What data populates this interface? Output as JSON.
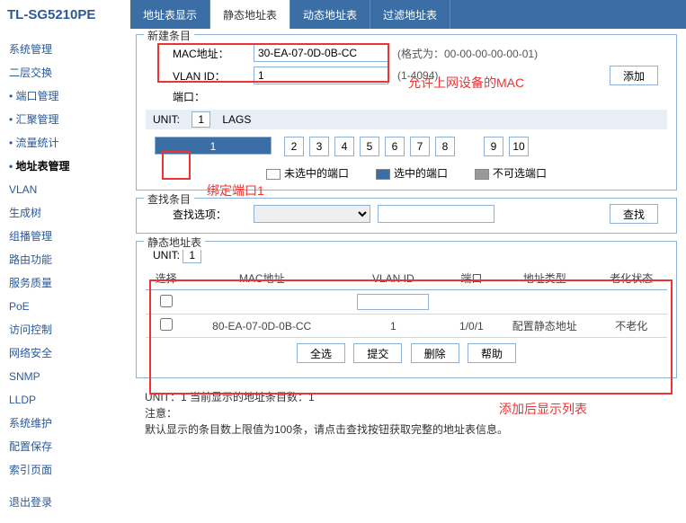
{
  "logo": "TL-SG5210PE",
  "tabs": [
    "地址表显示",
    "静态地址表",
    "动态地址表",
    "过滤地址表"
  ],
  "activeTab": 1,
  "sidebar": [
    {
      "label": "系统管理",
      "sub": false
    },
    {
      "label": "二层交换",
      "sub": false
    },
    {
      "label": "端口管理",
      "sub": true
    },
    {
      "label": "汇聚管理",
      "sub": true
    },
    {
      "label": "流量统计",
      "sub": true
    },
    {
      "label": "地址表管理",
      "sub": true,
      "active": true
    },
    {
      "label": "VLAN",
      "sub": false
    },
    {
      "label": "生成树",
      "sub": false
    },
    {
      "label": "组播管理",
      "sub": false
    },
    {
      "label": "路由功能",
      "sub": false
    },
    {
      "label": "服务质量",
      "sub": false
    },
    {
      "label": "PoE",
      "sub": false
    },
    {
      "label": "访问控制",
      "sub": false
    },
    {
      "label": "网络安全",
      "sub": false
    },
    {
      "label": "SNMP",
      "sub": false
    },
    {
      "label": "LLDP",
      "sub": false
    },
    {
      "label": "系统维护",
      "sub": false
    },
    {
      "label": "配置保存",
      "sub": false
    },
    {
      "label": "索引页面",
      "sub": false
    },
    {
      "label": "退出登录",
      "sub": false
    }
  ],
  "create": {
    "legend": "新建条目",
    "mac_lbl": "MAC地址：",
    "mac_val": "30-EA-07-0D-0B-CC",
    "mac_hint": "(格式为：00-00-00-00-00-01)",
    "vlan_lbl": "VLAN ID：",
    "vlan_val": "1",
    "vlan_hint": "(1-4094)",
    "port_lbl": "端口：",
    "add_btn": "添加",
    "unit_lbl": "UNIT:",
    "unit_val": "1",
    "lags": "LAGS",
    "ports": [
      "1",
      "2",
      "3",
      "4",
      "5",
      "6",
      "7",
      "8",
      "9",
      "10"
    ],
    "leg_unsel": "未选中的端口",
    "leg_sel": "选中的端口",
    "leg_dis": "不可选端口"
  },
  "search": {
    "legend": "查找条目",
    "opt_lbl": "查找选项：",
    "btn": "查找"
  },
  "tbl": {
    "legend": "静态地址表",
    "unit_lbl": "UNIT:",
    "unit_val": "1",
    "cols": [
      "选择",
      "MAC地址",
      "VLAN ID",
      "端口",
      "地址类型",
      "老化状态"
    ],
    "row": {
      "mac": "80-EA-07-0D-0B-CC",
      "vlan": "1",
      "port": "1/0/1",
      "type": "配置静态地址",
      "age": "不老化"
    },
    "btns": [
      "全选",
      "提交",
      "删除",
      "帮助"
    ]
  },
  "note": {
    "unit": "UNIT：1  当前显示的地址条目数：1",
    "h": "注意：",
    "t": "默认显示的条目数上限值为100条，请点击查找按钮获取完整的地址表信息。"
  },
  "ann": {
    "mac": "允许上网设备的MAC",
    "port": "绑定端口1",
    "list": "添加后显示列表"
  }
}
